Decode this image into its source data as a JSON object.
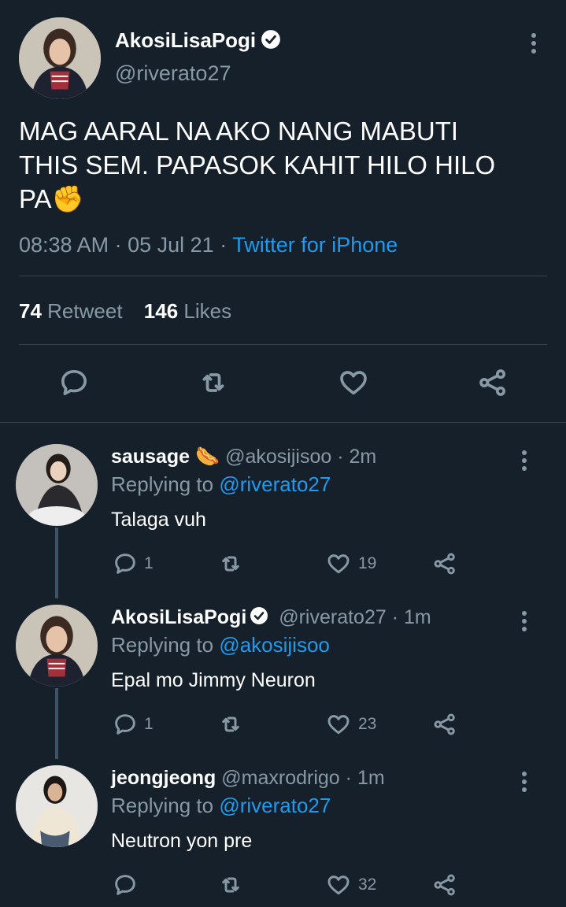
{
  "main_tweet": {
    "author_name": "AkosiLisaPogi",
    "author_handle": "@riverato27",
    "text_line1": "MAG AARAL NA AKO NANG MABUTI",
    "text_line2": "THIS SEM. PAPASOK KAHIT HILO HILO",
    "text_line3": "PA✊",
    "time": "08:38 AM",
    "date": "05 Jul 21",
    "separator": "·",
    "source": "Twitter for iPhone",
    "retweet_count": "74",
    "retweet_label": "Retweet",
    "likes_count": "146",
    "likes_label": "Likes"
  },
  "replies": [
    {
      "name": "sausage",
      "emoji": "🌭",
      "handle": "@akosijisoo",
      "time": "· 2m",
      "replying_label": "Replying to",
      "replying_to": "@riverato27",
      "text": "Talaga vuh",
      "reply_count": "1",
      "retweet_count": "",
      "like_count": "19"
    },
    {
      "name": "AkosiLisaPogi",
      "emoji": "",
      "handle": "@riverato27",
      "time": "· 1m",
      "replying_label": "Replying to",
      "replying_to": "@akosijisoo",
      "text": "Epal mo Jimmy Neuron",
      "reply_count": "1",
      "retweet_count": "",
      "like_count": "23"
    },
    {
      "name": "jeongjeong",
      "emoji": "",
      "handle": "@maxrodrigo",
      "time": "· 1m",
      "replying_label": "Replying to",
      "replying_to": "@riverato27",
      "text": "Neutron yon pre",
      "reply_count": "",
      "retweet_count": "",
      "like_count": "32"
    }
  ],
  "colors": {
    "background": "#15202b",
    "muted_text": "#8899a6",
    "link": "#1d9bf0",
    "divider": "#38444d"
  }
}
